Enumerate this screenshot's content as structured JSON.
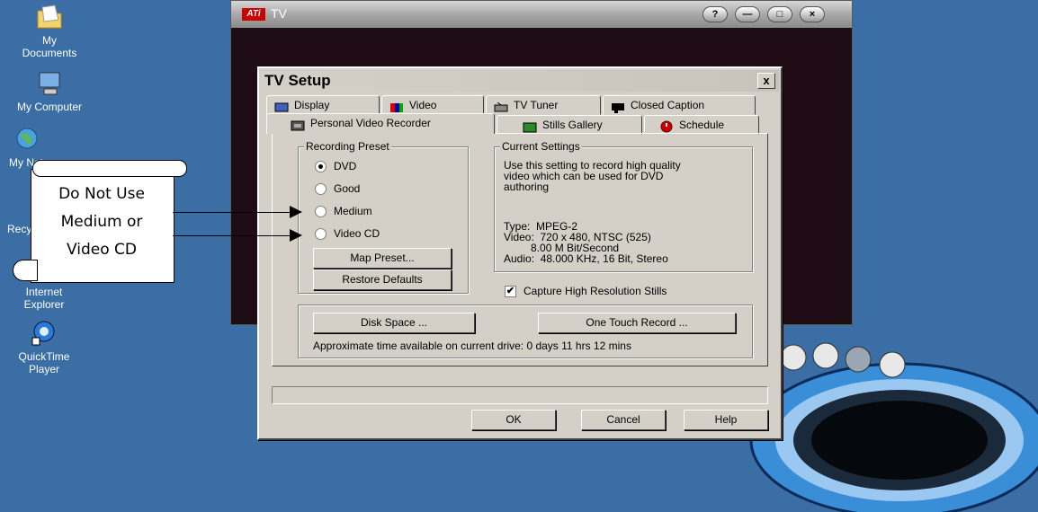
{
  "desktop": {
    "icons": [
      {
        "label_lines": [
          "My",
          "Documents"
        ]
      },
      {
        "label_lines": [
          "My Computer"
        ]
      },
      {
        "label_lines": [
          "My Network Places"
        ]
      },
      {
        "label_lines": [
          "Recycle Bin"
        ]
      },
      {
        "label_lines": [
          "Internet",
          "Explorer"
        ]
      },
      {
        "label_lines": [
          "QuickTime",
          "Player"
        ]
      }
    ]
  },
  "tv_window": {
    "logo": "ATi",
    "title": "TV",
    "buttons": [
      "?",
      "—",
      "□",
      "×"
    ]
  },
  "dialog": {
    "title": "TV Setup",
    "close_label": "x",
    "tabs_row1": [
      "Display",
      "Video",
      "TV Tuner",
      "Closed Caption"
    ],
    "tabs_row2": [
      "Personal Video Recorder",
      "Stills Gallery",
      "Schedule"
    ],
    "recording_preset": {
      "label": "Recording Preset",
      "options": [
        "DVD",
        "Good",
        "Medium",
        "Video CD"
      ],
      "selected": "DVD",
      "map_preset_button": "Map Preset...",
      "restore_defaults_button": "Restore Defaults"
    },
    "current_settings": {
      "label": "Current Settings",
      "description": "Use this setting to record high quality\nvideo which can be used for DVD\nauthoring",
      "details": "Type:  MPEG-2\nVideo:  720 x 480, NTSC (525)\n         8.00 M Bit/Second\nAudio:  48.000 KHz, 16 Bit, Stereo"
    },
    "capture_high_res": {
      "label": "Capture High Resolution Stills",
      "checked": true
    },
    "disk_space_button": "Disk Space ...",
    "one_touch_record_button": "One Touch Record ...",
    "time_available": "Approximate time available on current drive: 0 days 11 hrs 12 mins",
    "ok_button": "OK",
    "cancel_button": "Cancel",
    "help_button": "Help"
  },
  "annotation": {
    "lines": [
      "Do Not Use",
      "Medium or",
      "Video CD"
    ]
  },
  "colors": {
    "desktop": "#3a6ea5",
    "dialog": "#d4d0c8",
    "tv_inner": "#200c14"
  }
}
